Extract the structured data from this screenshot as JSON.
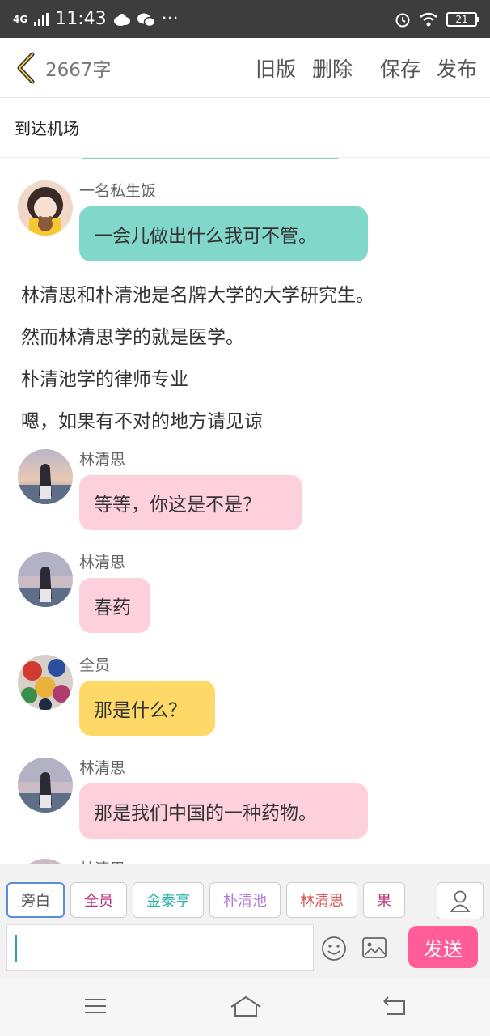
{
  "status_bar": {
    "network": "4G",
    "time": "11:43",
    "battery": "21",
    "icons": [
      "cloud-icon",
      "wechat-icon",
      "more-dots-icon",
      "alarm-icon",
      "wifi-icon",
      "battery-icon"
    ]
  },
  "toolbar": {
    "back_icon": "chevron-left-icon",
    "word_count": "2667字",
    "old_version": "旧版",
    "delete": "删除",
    "save": "保存",
    "publish": "发布"
  },
  "chapter_title": "到达机场",
  "messages": [
    {
      "name": "一名私生饭",
      "text": "一会儿做出什么我可不管。",
      "bubble_color": "#82d7cb",
      "avatar": "girl-with-bear-avatar"
    },
    {
      "name": "林清思",
      "text": "等等，你这是不是？",
      "bubble_color": "#fdd0dc",
      "avatar": "sunset-girl-avatar"
    },
    {
      "name": "林清思",
      "text": "春药",
      "bubble_color": "#fdd0dc",
      "avatar": "sunset-girl-avatar"
    },
    {
      "name": "全员",
      "text": "那是什么？",
      "bubble_color": "#ffd967",
      "avatar": "group-colorful-avatar"
    },
    {
      "name": "林清思",
      "text": "那是我们中国的一种药物。",
      "bubble_color": "#fdd0dc",
      "avatar": "sunset-girl-avatar"
    }
  ],
  "narration": [
    "林清思和朴清池是名牌大学的大学研究生。",
    "然而林清思学的就是医学。",
    "朴清池学的律师专业",
    "嗯，如果有不对的地方请见谅"
  ],
  "cutoff_name": "林清思",
  "roles": [
    {
      "label": "旁白",
      "color": "#555555"
    },
    {
      "label": "全员",
      "color": "#c0307a"
    },
    {
      "label": "金泰亨",
      "color": "#25b3a8"
    },
    {
      "label": "朴清池",
      "color": "#b07ad8"
    },
    {
      "label": "林清思",
      "color": "#d9534f"
    },
    {
      "label": "果",
      "color": "#c0307a"
    }
  ],
  "input": {
    "placeholder": "",
    "value": ""
  },
  "send_label": "发送",
  "nav": {
    "menu_icon": "menu-icon",
    "home_icon": "home-icon",
    "back_icon": "return-icon"
  }
}
